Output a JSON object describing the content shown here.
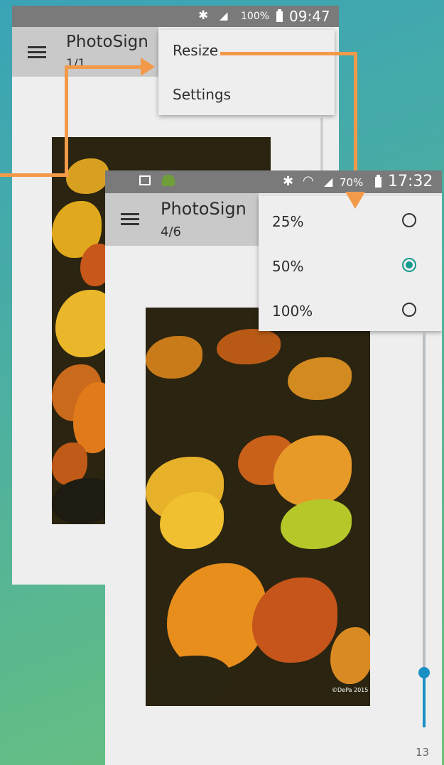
{
  "back_screen": {
    "status": {
      "bluetooth_icon": "bluetooth-icon",
      "battery_percent": "100%",
      "time": "09:47"
    },
    "app": {
      "title": "PhotoSign",
      "counter": "1/1"
    },
    "menu": {
      "items": [
        "Resize",
        "Settings"
      ]
    }
  },
  "front_screen": {
    "status": {
      "time": "17:32",
      "battery_percent": "70%"
    },
    "app": {
      "title": "PhotoSign",
      "counter": "4/6"
    },
    "resize_options": [
      {
        "label": "25%",
        "selected": false
      },
      {
        "label": "50%",
        "selected": true
      },
      {
        "label": "100%",
        "selected": false
      }
    ],
    "slider": {
      "value": "13",
      "level_fraction": 0.14
    },
    "watermark": "©DePa 2015"
  },
  "colors": {
    "accent": "#149b8f",
    "slider": "#1a8fc4",
    "arrow": "#f39a4a",
    "statusbar": "#7a7a7a",
    "appbar": "#c9c9c9"
  }
}
